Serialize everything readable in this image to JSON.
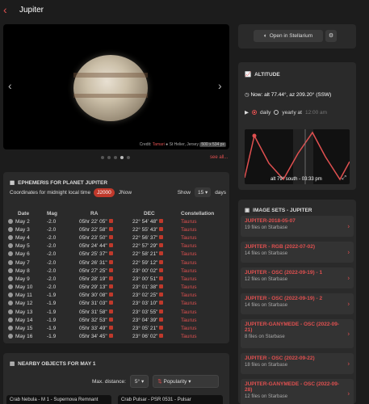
{
  "header": {
    "back": "‹",
    "title": "Jupiter"
  },
  "image": {
    "credit_prefix": "Credit:",
    "credit_name": "Tamari",
    "location": "St Helier, Jersey",
    "size": "500 x 534 px",
    "see_all": "see all..."
  },
  "ephemeris": {
    "title": "EPHEMERIS FOR PLANET JUPITER",
    "coords_label": "Coordinates for midnight local time",
    "j2000": "J2000",
    "jnow": "JNow",
    "show_label": "Show",
    "days_value": "15",
    "days_label": "days",
    "headers": [
      "Date",
      "Mag",
      "RA",
      "DEC",
      "Constellation"
    ],
    "rows": [
      [
        "May 2",
        "-2.0",
        "05hr 22' 05\"",
        "22° 54' 48\"",
        "Taurus"
      ],
      [
        "May 3",
        "-2.0",
        "05hr 22' 58\"",
        "22° 55' 43\"",
        "Taurus"
      ],
      [
        "May 4",
        "-2.0",
        "05hr 23' 50\"",
        "22° 56' 37\"",
        "Taurus"
      ],
      [
        "May 5",
        "-2.0",
        "05hr 24' 44\"",
        "22° 57' 29\"",
        "Taurus"
      ],
      [
        "May 6",
        "-2.0",
        "05hr 25' 37\"",
        "22° 58' 21\"",
        "Taurus"
      ],
      [
        "May 7",
        "-2.0",
        "05hr 26' 31\"",
        "22° 59' 12\"",
        "Taurus"
      ],
      [
        "May 8",
        "-2.0",
        "05hr 27' 25\"",
        "23° 00' 02\"",
        "Taurus"
      ],
      [
        "May 9",
        "-2.0",
        "05hr 28' 19\"",
        "23° 00' 51\"",
        "Taurus"
      ],
      [
        "May 10",
        "-2.0",
        "05hr 29' 13\"",
        "23° 01' 38\"",
        "Taurus"
      ],
      [
        "May 11",
        "-1.9",
        "05hr 30' 08\"",
        "23° 02' 25\"",
        "Taurus"
      ],
      [
        "May 12",
        "-1.9",
        "05hr 31' 03\"",
        "23° 03' 10\"",
        "Taurus"
      ],
      [
        "May 13",
        "-1.9",
        "05hr 31' 58\"",
        "23° 03' 55\"",
        "Taurus"
      ],
      [
        "May 14",
        "-1.9",
        "05hr 32' 53\"",
        "23° 04' 39\"",
        "Taurus"
      ],
      [
        "May 15",
        "-1.9",
        "05hr 33' 49\"",
        "23° 05' 21\"",
        "Taurus"
      ],
      [
        "May 16",
        "-1.9",
        "05hr 34' 45\"",
        "23° 06' 02\"",
        "Taurus"
      ]
    ]
  },
  "nearby": {
    "title": "NEARBY OBJECTS FOR MAY 1",
    "max_label": "Max. distance:",
    "max_value": "5°",
    "sort_value": "Popularity",
    "items": [
      "Crab Nebula - M 1 - Supernova Remnant",
      "Crab Pulsar - PSR 0531 - Pulsar"
    ]
  },
  "stellarium": {
    "button": "Open in Stellarium"
  },
  "altitude": {
    "title": "ALTITUDE",
    "now": "Now: alt 77.44°, az 209.20° (SSW)",
    "daily": "daily",
    "yearly": "yearly at",
    "time": "12:00 am",
    "chart_label": "alt 79° south - 03:33 pm"
  },
  "image_sets": {
    "title": "IMAGE SETS - JUPITER",
    "items": [
      {
        "name": "JUPITER-2018-05-07",
        "files": "19 files on Starbase"
      },
      {
        "name": "JUPITER - RGB (2022-07-02)",
        "files": "14 files on Starbase"
      },
      {
        "name": "JUPITER - OSC (2022-09-19) - 1",
        "files": "12 files on Starbase"
      },
      {
        "name": "JUPITER - OSC (2022-09-19) - 2",
        "files": "14 files on Starbase"
      },
      {
        "name": "JUPITER-GANYMEDE - OSC (2022-09-21)",
        "files": "8 files on Starbase"
      },
      {
        "name": "JUPITER - OSC (2022-09-22)",
        "files": "18 files on Starbase"
      },
      {
        "name": "JUPITER-GANYMEDE - OSC (2022-09-28)",
        "files": "12 files on Starbase"
      }
    ]
  }
}
